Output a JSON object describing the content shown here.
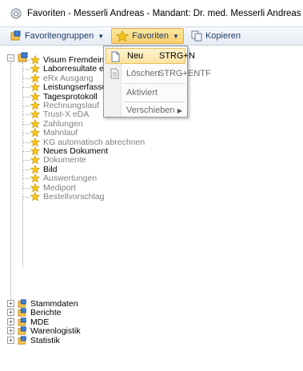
{
  "window": {
    "title": "Favoriten - Messerli Andreas - Mandant: Dr. med. Messerli Andreas"
  },
  "toolbar": {
    "favoritengruppen_label": "Favoritengruppen",
    "favoriten_label": "Favoriten",
    "kopieren_label": "Kopieren"
  },
  "menu": {
    "items": [
      {
        "label": "Neu",
        "shortcut": "STRG+N",
        "state": "highlighted"
      },
      {
        "label": "Löschen",
        "shortcut": "STRG+ENTF",
        "state": "dim"
      },
      {
        "label": "Aktiviert",
        "shortcut": "",
        "state": "dim"
      },
      {
        "label": "Verschieben",
        "shortcut": "",
        "state": "dim",
        "submenu": true
      }
    ]
  },
  "tree": {
    "favorites": [
      {
        "label": "Visum Fremdeinträge",
        "disabled": false
      },
      {
        "label": "Laborresultate einlesen",
        "disabled": false
      },
      {
        "label": "eRx Ausgang",
        "disabled": true
      },
      {
        "label": "Leistungserfassung",
        "disabled": false
      },
      {
        "label": "Tagesprotokoll",
        "disabled": false
      },
      {
        "label": "Rechnungslauf",
        "disabled": true
      },
      {
        "label": "Trust-X eDA",
        "disabled": true
      },
      {
        "label": "Zahlungen",
        "disabled": true
      },
      {
        "label": "Mahnlauf",
        "disabled": true
      },
      {
        "label": "KG automatisch abrechnen",
        "disabled": true
      },
      {
        "label": "Neues Dokument",
        "disabled": false
      },
      {
        "label": "Dokumente",
        "disabled": true
      },
      {
        "label": "Bild",
        "disabled": false
      },
      {
        "label": "Auswertungen",
        "disabled": true
      },
      {
        "label": "Mediport",
        "disabled": true
      },
      {
        "label": "Bestellvorschlag",
        "disabled": true
      }
    ],
    "groups": [
      {
        "label": "Stammdaten"
      },
      {
        "label": "Berichte"
      },
      {
        "label": "MDE"
      },
      {
        "label": "Warenlogistik"
      },
      {
        "label": "Statistik"
      }
    ]
  },
  "colors": {
    "toolbar_text": "#1e3b69",
    "star": "#f5c518",
    "highlight": "#fbe3a0",
    "disabled_text": "#808080"
  },
  "icons": {
    "app": "gear-heart-icon",
    "group": "folder-flag-icon",
    "favorite": "star-icon",
    "kopieren": "copy-icon",
    "neu": "new-document-icon",
    "loeschen": "delete-document-icon"
  }
}
